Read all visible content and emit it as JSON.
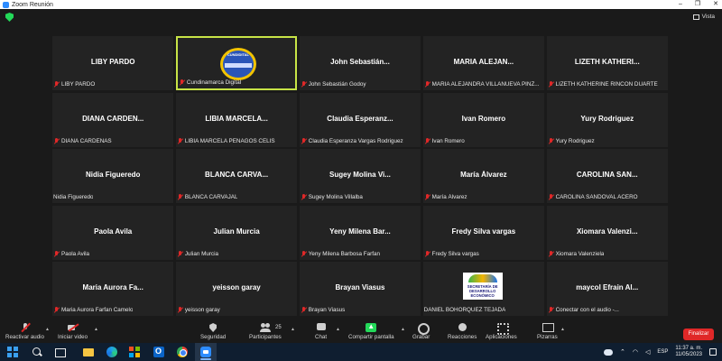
{
  "window": {
    "title": "Zoom Reunión",
    "controls": [
      "–",
      "❐",
      "✕"
    ]
  },
  "topbar": {
    "view_label": "Vista",
    "view_icon": "gallery-grid-icon"
  },
  "accent": {
    "active_speaker": "#c7e346",
    "muted": "#e02828",
    "share": "#23d959",
    "end": "#e02828"
  },
  "tiles": [
    {
      "display": "LIBY PARDO",
      "name": "LIBY PARDO"
    },
    {
      "display": "",
      "name": "Cundinamarca Digital",
      "logo": "cundinamarca-logo",
      "logo_text": "CUNDIDITAL",
      "active": true
    },
    {
      "display": "John Sebastián...",
      "name": "John Sebastián Godoy"
    },
    {
      "display": "MARIA ALEJAN...",
      "name": "MARIA ALEJANDRA VILLANUEVA PINZ..."
    },
    {
      "display": "LIZETH KATHERI...",
      "name": "LIZETH KATHERINE RINCON DUARTE"
    },
    {
      "display": "DIANA CARDEN...",
      "name": "DIANA CARDENAS"
    },
    {
      "display": "LIBIA MARCELA...",
      "name": "LIBIA MARCELA PENAGOS CELIS"
    },
    {
      "display": "Claudia Esperanz...",
      "name": "Claudia Esperanza Vargas Rodriguez"
    },
    {
      "display": "Ivan Romero",
      "name": "Ivan Romero"
    },
    {
      "display": "Yury Rodriguez",
      "name": "Yury Rodriguez"
    },
    {
      "display": "Nidia Figueredo",
      "name": "Nidia Figueredo",
      "unmuted": true
    },
    {
      "display": "BLANCA CARVA...",
      "name": "BLANCA CARVAJAL"
    },
    {
      "display": "Sugey Molina Vi...",
      "name": "Sugey Molina Villalba"
    },
    {
      "display": "María Álvarez",
      "name": "María Álvarez"
    },
    {
      "display": "CAROLINA SAN...",
      "name": "CAROLINA SANDOVAL ACERO"
    },
    {
      "display": "Paola Avila",
      "name": "Paola Avila"
    },
    {
      "display": "Julian Murcia",
      "name": "Julian Murcia"
    },
    {
      "display": "Yeny Milena Bar...",
      "name": "Yeny Milena Barbosa Farfan"
    },
    {
      "display": "Fredy Silva vargas",
      "name": "Fredy Silva vargas"
    },
    {
      "display": "Xiomara Valenzi...",
      "name": "Xiomara Valenziela"
    },
    {
      "display": "Maria Aurora Fa...",
      "name": "Maria Aurora Farfan Camelo"
    },
    {
      "display": "yeisson garay",
      "name": "yeisson garay"
    },
    {
      "display": "Brayan Viasus",
      "name": "Brayan Viasus"
    },
    {
      "display": "",
      "name": "DANIEL BOHÓRQUEZ TEJADA",
      "logo": "desarrollo-economico-logo",
      "logo_text": "SECRETARÍA DE DESARROLLO ECONÓMICO",
      "unmuted": true
    },
    {
      "display": "maycol Efrain Al...",
      "name": "Conectar con el audio -..."
    }
  ],
  "toolbar": {
    "reactivar_audio": "Reactivar audio",
    "iniciar_video": "Iniciar video",
    "seguridad": "Seguridad",
    "participantes": "Participantes",
    "participant_count": "25",
    "chat": "Chat",
    "compartir": "Compartir pantalla",
    "grabar": "Grabar",
    "reacciones": "Reacciones",
    "aplicaciones": "Aplicaciones",
    "pizarras": "Pizarras",
    "finalizar": "Finalizar"
  },
  "taskbar": {
    "lang": "ESP",
    "time": "11:37 a. m.",
    "date": "11/05/2023"
  }
}
